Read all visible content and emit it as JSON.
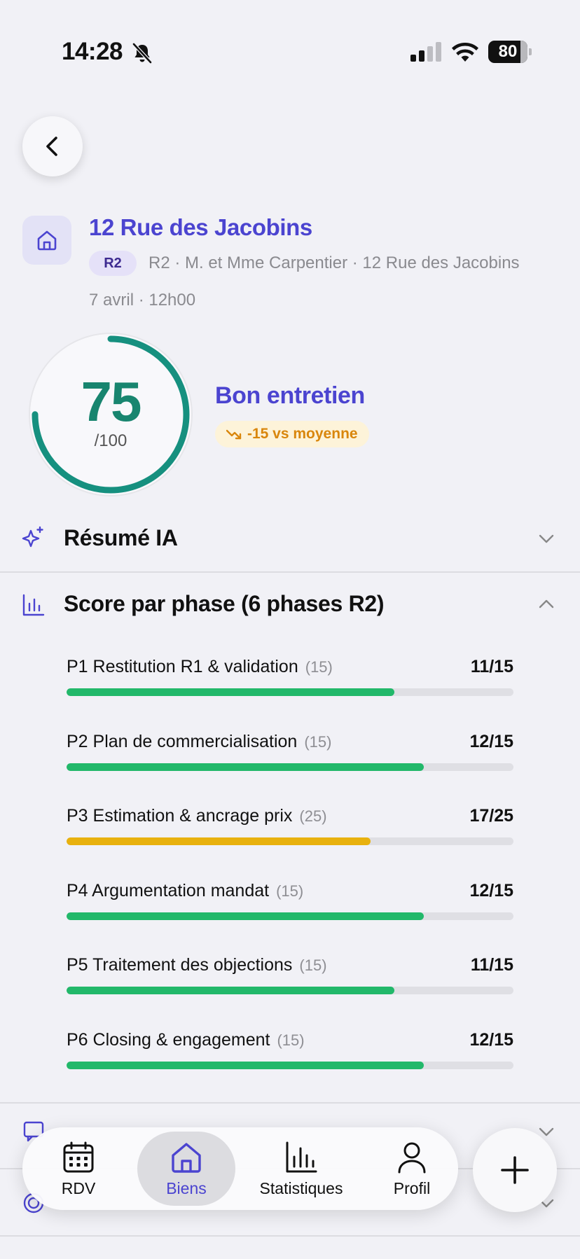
{
  "status_bar": {
    "time": "14:28",
    "battery": "80"
  },
  "property": {
    "title": "12 Rue des Jacobins",
    "badge": "R2",
    "subtitle": "R2 · M. et Mme Carpentier · 12 Rue des Jacobins",
    "date": "7 avril · 12h00"
  },
  "score": {
    "value": "75",
    "max": "/100",
    "fraction": 0.75,
    "verdict": "Bon entretien",
    "trend": "-15 vs moyenne",
    "colors": {
      "ring": "#16907f",
      "verdict": "#4b44d0",
      "trend": "#d9860c"
    }
  },
  "sections": {
    "resume": {
      "title": "Résumé IA"
    },
    "phases": {
      "title": "Score par phase (6 phases R2)"
    }
  },
  "phases": [
    {
      "name": "P1 Restitution R1 & validation",
      "max_label": "(15)",
      "score": "11/15",
      "fraction": 0.7333,
      "color": "#22b86a"
    },
    {
      "name": "P2 Plan de commercialisation",
      "max_label": "(15)",
      "score": "12/15",
      "fraction": 0.8,
      "color": "#22b86a"
    },
    {
      "name": "P3 Estimation & ancrage prix",
      "max_label": "(25)",
      "score": "17/25",
      "fraction": 0.68,
      "color": "#e8b10e"
    },
    {
      "name": "P4 Argumentation mandat",
      "max_label": "(15)",
      "score": "12/15",
      "fraction": 0.8,
      "color": "#22b86a"
    },
    {
      "name": "P5 Traitement des objections",
      "max_label": "(15)",
      "score": "11/15",
      "fraction": 0.7333,
      "color": "#22b86a"
    },
    {
      "name": "P6 Closing & engagement",
      "max_label": "(15)",
      "score": "12/15",
      "fraction": 0.8,
      "color": "#22b86a"
    }
  ],
  "nav": {
    "items": [
      {
        "label": "RDV",
        "icon": "calendar-icon"
      },
      {
        "label": "Biens",
        "icon": "home-icon",
        "active": true
      },
      {
        "label": "Statistiques",
        "icon": "chart-icon"
      },
      {
        "label": "Profil",
        "icon": "user-icon"
      }
    ],
    "fab_icon": "plus-icon",
    "active_color": "#4b44d0"
  }
}
